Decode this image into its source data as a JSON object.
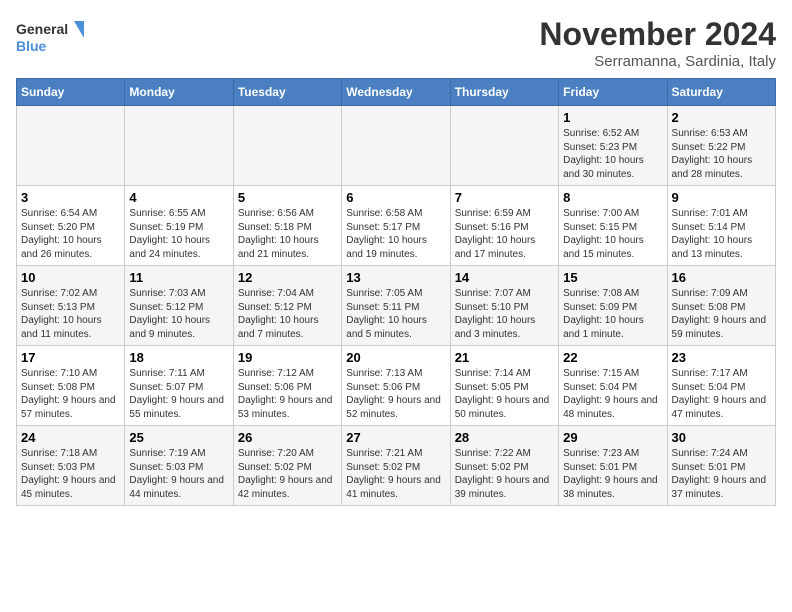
{
  "logo": {
    "line1": "General",
    "line2": "Blue"
  },
  "title": "November 2024",
  "subtitle": "Serramanna, Sardinia, Italy",
  "days_header": [
    "Sunday",
    "Monday",
    "Tuesday",
    "Wednesday",
    "Thursday",
    "Friday",
    "Saturday"
  ],
  "weeks": [
    [
      {
        "day": "",
        "info": ""
      },
      {
        "day": "",
        "info": ""
      },
      {
        "day": "",
        "info": ""
      },
      {
        "day": "",
        "info": ""
      },
      {
        "day": "",
        "info": ""
      },
      {
        "day": "1",
        "info": "Sunrise: 6:52 AM\nSunset: 5:23 PM\nDaylight: 10 hours and 30 minutes."
      },
      {
        "day": "2",
        "info": "Sunrise: 6:53 AM\nSunset: 5:22 PM\nDaylight: 10 hours and 28 minutes."
      }
    ],
    [
      {
        "day": "3",
        "info": "Sunrise: 6:54 AM\nSunset: 5:20 PM\nDaylight: 10 hours and 26 minutes."
      },
      {
        "day": "4",
        "info": "Sunrise: 6:55 AM\nSunset: 5:19 PM\nDaylight: 10 hours and 24 minutes."
      },
      {
        "day": "5",
        "info": "Sunrise: 6:56 AM\nSunset: 5:18 PM\nDaylight: 10 hours and 21 minutes."
      },
      {
        "day": "6",
        "info": "Sunrise: 6:58 AM\nSunset: 5:17 PM\nDaylight: 10 hours and 19 minutes."
      },
      {
        "day": "7",
        "info": "Sunrise: 6:59 AM\nSunset: 5:16 PM\nDaylight: 10 hours and 17 minutes."
      },
      {
        "day": "8",
        "info": "Sunrise: 7:00 AM\nSunset: 5:15 PM\nDaylight: 10 hours and 15 minutes."
      },
      {
        "day": "9",
        "info": "Sunrise: 7:01 AM\nSunset: 5:14 PM\nDaylight: 10 hours and 13 minutes."
      }
    ],
    [
      {
        "day": "10",
        "info": "Sunrise: 7:02 AM\nSunset: 5:13 PM\nDaylight: 10 hours and 11 minutes."
      },
      {
        "day": "11",
        "info": "Sunrise: 7:03 AM\nSunset: 5:12 PM\nDaylight: 10 hours and 9 minutes."
      },
      {
        "day": "12",
        "info": "Sunrise: 7:04 AM\nSunset: 5:12 PM\nDaylight: 10 hours and 7 minutes."
      },
      {
        "day": "13",
        "info": "Sunrise: 7:05 AM\nSunset: 5:11 PM\nDaylight: 10 hours and 5 minutes."
      },
      {
        "day": "14",
        "info": "Sunrise: 7:07 AM\nSunset: 5:10 PM\nDaylight: 10 hours and 3 minutes."
      },
      {
        "day": "15",
        "info": "Sunrise: 7:08 AM\nSunset: 5:09 PM\nDaylight: 10 hours and 1 minute."
      },
      {
        "day": "16",
        "info": "Sunrise: 7:09 AM\nSunset: 5:08 PM\nDaylight: 9 hours and 59 minutes."
      }
    ],
    [
      {
        "day": "17",
        "info": "Sunrise: 7:10 AM\nSunset: 5:08 PM\nDaylight: 9 hours and 57 minutes."
      },
      {
        "day": "18",
        "info": "Sunrise: 7:11 AM\nSunset: 5:07 PM\nDaylight: 9 hours and 55 minutes."
      },
      {
        "day": "19",
        "info": "Sunrise: 7:12 AM\nSunset: 5:06 PM\nDaylight: 9 hours and 53 minutes."
      },
      {
        "day": "20",
        "info": "Sunrise: 7:13 AM\nSunset: 5:06 PM\nDaylight: 9 hours and 52 minutes."
      },
      {
        "day": "21",
        "info": "Sunrise: 7:14 AM\nSunset: 5:05 PM\nDaylight: 9 hours and 50 minutes."
      },
      {
        "day": "22",
        "info": "Sunrise: 7:15 AM\nSunset: 5:04 PM\nDaylight: 9 hours and 48 minutes."
      },
      {
        "day": "23",
        "info": "Sunrise: 7:17 AM\nSunset: 5:04 PM\nDaylight: 9 hours and 47 minutes."
      }
    ],
    [
      {
        "day": "24",
        "info": "Sunrise: 7:18 AM\nSunset: 5:03 PM\nDaylight: 9 hours and 45 minutes."
      },
      {
        "day": "25",
        "info": "Sunrise: 7:19 AM\nSunset: 5:03 PM\nDaylight: 9 hours and 44 minutes."
      },
      {
        "day": "26",
        "info": "Sunrise: 7:20 AM\nSunset: 5:02 PM\nDaylight: 9 hours and 42 minutes."
      },
      {
        "day": "27",
        "info": "Sunrise: 7:21 AM\nSunset: 5:02 PM\nDaylight: 9 hours and 41 minutes."
      },
      {
        "day": "28",
        "info": "Sunrise: 7:22 AM\nSunset: 5:02 PM\nDaylight: 9 hours and 39 minutes."
      },
      {
        "day": "29",
        "info": "Sunrise: 7:23 AM\nSunset: 5:01 PM\nDaylight: 9 hours and 38 minutes."
      },
      {
        "day": "30",
        "info": "Sunrise: 7:24 AM\nSunset: 5:01 PM\nDaylight: 9 hours and 37 minutes."
      }
    ]
  ]
}
